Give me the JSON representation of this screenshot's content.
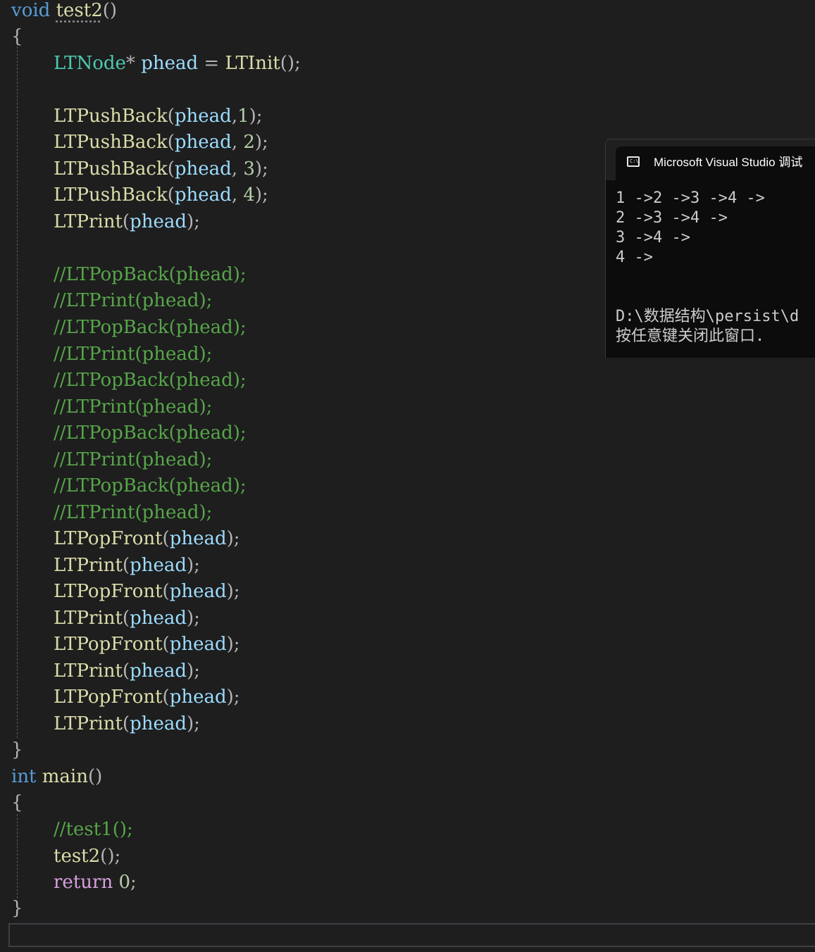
{
  "code": {
    "l1": {
      "kw": "void",
      "fn": "test2",
      "p": "()"
    },
    "l2": {
      "brace": "{"
    },
    "l3": {
      "type": "LTNode",
      "star": "*",
      "var": "phead",
      "eq": "=",
      "fn": "LTInit",
      "p": "();"
    },
    "l5": {
      "fn": "LTPushBack",
      "open": "(",
      "var": "phead",
      "comma": ",",
      "num": "1",
      "close": ");"
    },
    "l6": {
      "fn": "LTPushBack",
      "open": "(",
      "var": "phead",
      "comma": ", ",
      "num": "2",
      "close": ");"
    },
    "l7": {
      "fn": "LTPushBack",
      "open": "(",
      "var": "phead",
      "comma": ", ",
      "num": "3",
      "close": ");"
    },
    "l8": {
      "fn": "LTPushBack",
      "open": "(",
      "var": "phead",
      "comma": ", ",
      "num": "4",
      "close": ");"
    },
    "l9": {
      "fn": "LTPrint",
      "open": "(",
      "var": "phead",
      "close": ");"
    },
    "comments": [
      "//LTPopBack(phead);",
      "//LTPrint(phead);",
      "//LTPopBack(phead);",
      "//LTPrint(phead);",
      "//LTPopBack(phead);",
      "//LTPrint(phead);",
      "//LTPopBack(phead);",
      "//LTPrint(phead);",
      "//LTPopBack(phead);",
      "//LTPrint(phead);"
    ],
    "calls": [
      {
        "fn": "LTPopFront",
        "open": "(",
        "var": "phead",
        "close": ");"
      },
      {
        "fn": "LTPrint",
        "open": "(",
        "var": "phead",
        "close": ");"
      },
      {
        "fn": "LTPopFront",
        "open": "(",
        "var": "phead",
        "close": ");"
      },
      {
        "fn": "LTPrint",
        "open": "(",
        "var": "phead",
        "close": ");"
      },
      {
        "fn": "LTPopFront",
        "open": "(",
        "var": "phead",
        "close": ");"
      },
      {
        "fn": "LTPrint",
        "open": "(",
        "var": "phead",
        "close": ");"
      },
      {
        "fn": "LTPopFront",
        "open": "(",
        "var": "phead",
        "close": ");"
      },
      {
        "fn": "LTPrint",
        "open": "(",
        "var": "phead",
        "close": ");"
      }
    ],
    "close1": "}",
    "main": {
      "kw": "int",
      "fn": "main",
      "p": "()"
    },
    "open2": "{",
    "m_comment": "//test1();",
    "m_call": {
      "fn": "test2",
      "p": "();"
    },
    "m_return": {
      "kw": "return",
      "num": "0",
      "semi": ";"
    },
    "close2": "}"
  },
  "console": {
    "title": "Microsoft Visual Studio 调试",
    "icon": "console-icon",
    "icon_glyph": "C:\\",
    "lines": [
      "1 ->2 ->3 ->4 ->",
      "2 ->3 ->4 ->",
      "3 ->4 ->",
      "4 ->",
      "",
      "",
      "D:\\数据结构\\persist\\d",
      "按任意键关闭此窗口."
    ]
  }
}
